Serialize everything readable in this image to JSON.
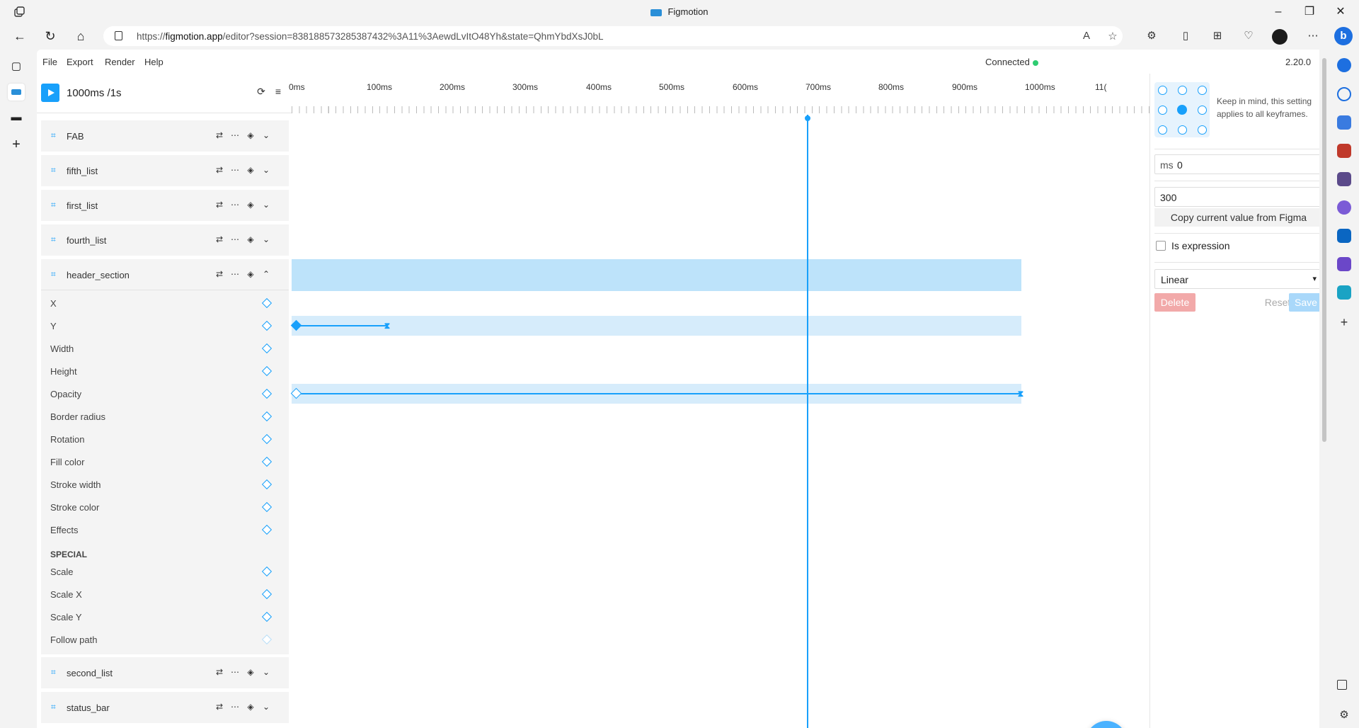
{
  "browser": {
    "title": "Figmotion",
    "url_prefix": "https://",
    "url_domain": "figmotion.app",
    "url_rest": "/editor?session=83818857328538743​2%3A11%3AewdLvItO48Yh&state=QhmYbdXsJ0bL"
  },
  "menu": {
    "file": "File",
    "export": "Export",
    "render": "Render",
    "help": "Help"
  },
  "status": {
    "connected": "Connected",
    "version": "2.20.0"
  },
  "controls": {
    "duration": "1000ms /1s"
  },
  "layers": [
    {
      "name": "FAB"
    },
    {
      "name": "fifth_list"
    },
    {
      "name": "first_list"
    },
    {
      "name": "fourth_list"
    },
    {
      "name": "header_section"
    },
    {
      "name": "second_list"
    },
    {
      "name": "status_bar"
    }
  ],
  "properties": [
    "X",
    "Y",
    "Width",
    "Height",
    "Opacity",
    "Border radius",
    "Rotation",
    "Fill color",
    "Stroke width",
    "Stroke color",
    "Effects"
  ],
  "special_heading": "SPECIAL",
  "special_properties": [
    "Scale",
    "Scale X",
    "Scale Y",
    "Follow path"
  ],
  "ruler": [
    "0ms",
    "100ms",
    "200ms",
    "300ms",
    "400ms",
    "500ms",
    "600ms",
    "700ms",
    "800ms",
    "900ms",
    "1000ms",
    "11("
  ],
  "keyframe_panel": {
    "note": "Keep in mind, this setting applies to all keyframes.",
    "ms_prefix": "ms",
    "ms_value": "0",
    "value": "300",
    "copy_label": "Copy current value from Figma",
    "expression_label": "Is expression",
    "easing": "Linear",
    "delete_label": "Delete",
    "reset_label": "Reset",
    "save_label": "Save"
  }
}
